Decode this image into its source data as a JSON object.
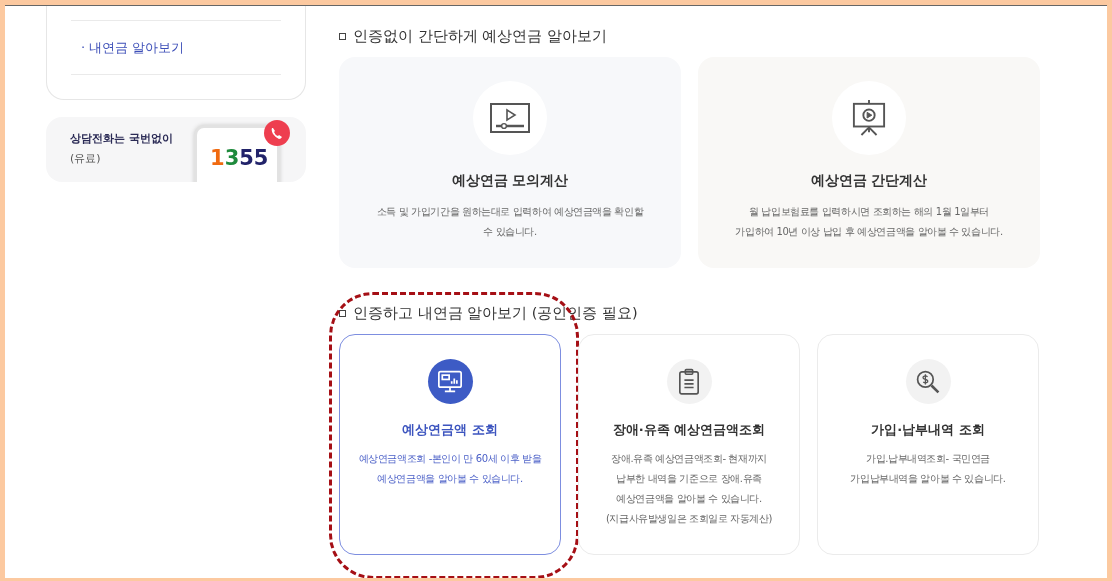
{
  "sidebar": {
    "menu_items": [
      {
        "label": "· 내연금 알아보기",
        "selected": true
      }
    ],
    "hotline": {
      "title": "상담전화는 국번없이",
      "note": "(유료)",
      "digits": [
        {
          "text": "1",
          "color": "#f06a10"
        },
        {
          "text": "3",
          "color": "#1e8a3c"
        },
        {
          "text": "55",
          "color": "#22236a"
        }
      ]
    }
  },
  "sections": [
    {
      "heading": "인증없이 간단하게 예상연금 알아보기",
      "cards": [
        {
          "title": "예상연금 모의계산",
          "description": "소득 및 가입기간을 원하는대로 입력하여 예상연금액을 확인할\n수 있습니다.",
          "selected": false,
          "highlighted": false
        },
        {
          "title": "예상연금 간단계산",
          "description": "월 납입보험료를 입력하시면 조회하는 해의 1월 1일부터\n가입하여 10년 이상 납입 후 예상연금액을 알아볼 수 있습니다.",
          "selected": false,
          "highlighted": false
        }
      ]
    },
    {
      "heading": "인증하고 내연금 알아보기 (공인인증 필요)",
      "cards": [
        {
          "title": "예상연금액 조회",
          "description": "예상연금액조회 -본인이 만 60세 이후 받을\n예상연금액을 알아볼 수 있습니다.",
          "selected": true,
          "highlighted": true
        },
        {
          "title": "장애·유족 예상연금액조회",
          "description": "장애.유족 예상연금액조회- 현재까지\n납부한 내역을 기준으로 장애.유족\n예상연금액을 알아볼 수 있습니다.\n(지급사유발생일은 조회일로 자동계산)",
          "selected": false,
          "highlighted": false
        },
        {
          "title": "가입·납부내역 조회",
          "description": "가입.납부내역조회- 국민연금\n가입납부내역을 알아볼 수 있습니다.",
          "selected": false,
          "highlighted": false
        }
      ]
    }
  ]
}
